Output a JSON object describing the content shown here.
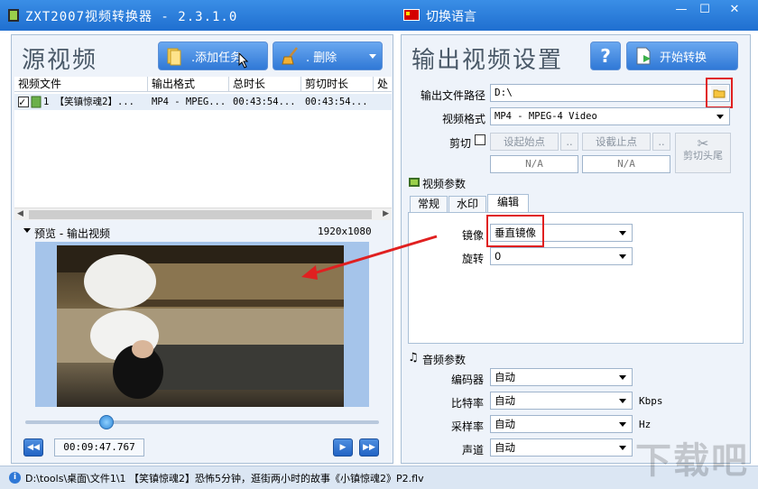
{
  "window": {
    "title": "ZXT2007视频转换器 - 2.3.1.0",
    "language_label": "切换语言",
    "min": "—",
    "max": "☐",
    "close": "✕"
  },
  "left": {
    "title": "源视频",
    "add_task": ".添加任务",
    "delete": ".    删除",
    "columns": [
      "视频文件",
      "输出格式",
      "总时长",
      "剪切时长",
      "处"
    ],
    "rows": [
      {
        "file": "1 【笑镇惊魂2】...",
        "format": "MP4 - MPEG...",
        "duration": "00:43:54...",
        "cut_duration": "00:43:54..."
      }
    ],
    "preview_label": "预览 - 输出视频",
    "resolution": "1920x1080",
    "time": "00:09:47.767",
    "progress": 0.23
  },
  "right": {
    "title": "输出视频设置",
    "help": "?",
    "start": "开始转换",
    "output_path_label": "输出文件路径",
    "output_path": "D:\\",
    "format_label": "视频格式",
    "format": "MP4 - MPEG-4 Video",
    "cut_label": "剪切",
    "set_start": "设起始点",
    "set_end": "设截止点",
    "ellipsis": "..",
    "start_value": "N/A",
    "end_value": "N/A",
    "cut_head_tail": "剪切头尾",
    "video_params": "视频参数",
    "tabs": [
      "常规",
      "水印",
      "编辑"
    ],
    "mirror_label": "镜像",
    "mirror": "垂直镜像",
    "rotate_label": "旋转",
    "rotate": "0",
    "audio_params": "音频参数",
    "encoder_label": "编码器",
    "encoder": "自动",
    "bitrate_label": "比特率",
    "bitrate": "自动",
    "bitrate_unit": "Kbps",
    "samplerate_label": "采样率",
    "samplerate": "自动",
    "samplerate_unit": "Hz",
    "channel_label": "声道",
    "channel": "自动"
  },
  "status": {
    "text": "D:\\tools\\桌面\\文件1\\1 【笑镇惊魂2】恐怖5分钟，逛街两小时的故事《小镇惊魂2》P2.flv"
  },
  "watermark": "下载吧"
}
